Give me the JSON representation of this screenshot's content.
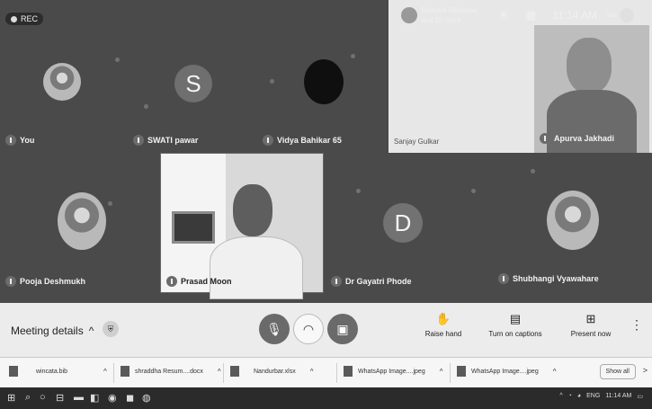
{
  "recording": {
    "label": "REC"
  },
  "notification": {
    "text_line1": "Swapnil Sahdane",
    "text_line2": "and 25 more"
  },
  "system": {
    "time": "11:14 AM",
    "you_label": "You"
  },
  "participants": [
    {
      "name": "You"
    },
    {
      "name": "SWATI pawar",
      "initial": "S"
    },
    {
      "name": "Vidya Bahikar 65"
    },
    {
      "name": "Pooja Deshmukh"
    },
    {
      "name": "Prasad Moon"
    },
    {
      "name": "Dr Gayatri Phode",
      "initial": "D"
    },
    {
      "name": "Shubhangi Vyawahare"
    }
  ],
  "presentation": {
    "presenter": "Sanjay Gulkar",
    "speaker_name": "Apurva Jakhadi"
  },
  "controls": {
    "meeting_details": "Meeting details",
    "raise_hand": "Raise hand",
    "captions": "Turn on captions",
    "present": "Present now"
  },
  "downloads": {
    "items": [
      {
        "name": "wincata.bib"
      },
      {
        "name": "shraddha Resum....docx"
      },
      {
        "name": "Nandurbar.xlsx"
      },
      {
        "name": "WhatsApp Image....jpeg"
      },
      {
        "name": "WhatsApp Image....jpeg"
      }
    ],
    "show_all": "Show all"
  },
  "taskbar": {
    "tray_text": "ENG",
    "tray_time": "11:14 AM"
  }
}
